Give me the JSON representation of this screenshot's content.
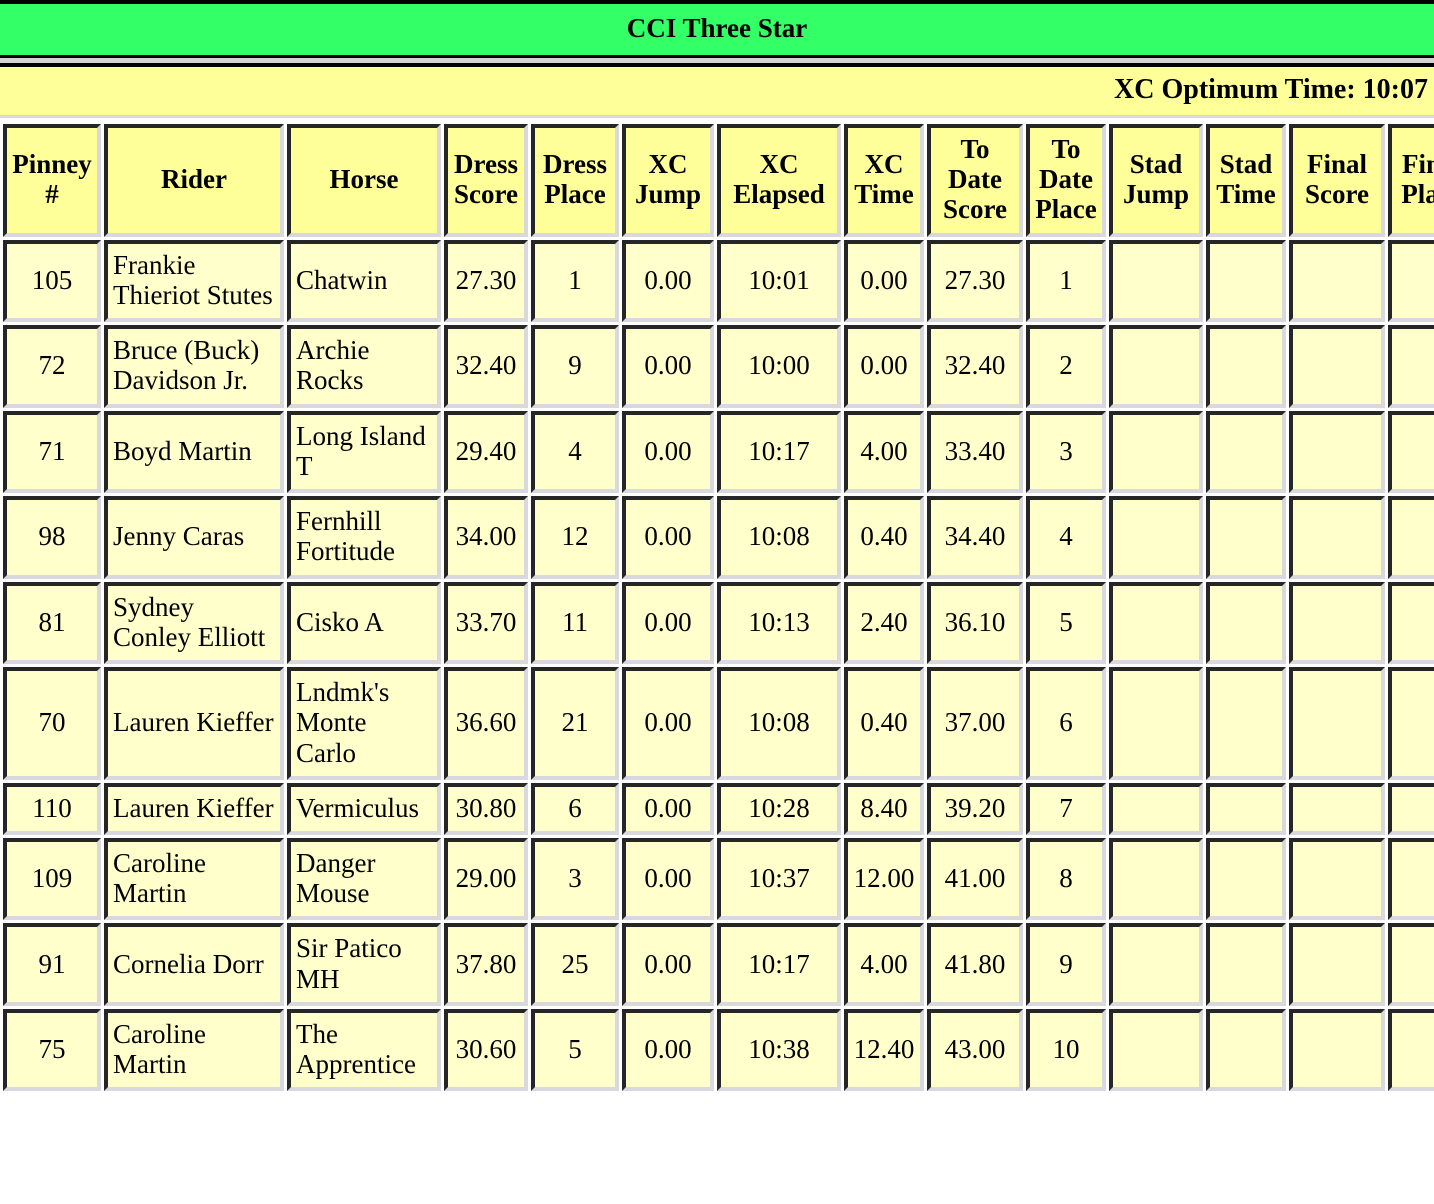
{
  "title": "CCI Three Star",
  "subtitle": "XC Optimum Time: 10:07",
  "colors": {
    "title_bar": "#33ff66",
    "header_cell": "#ffff99",
    "data_cell": "#ffffcc",
    "border_dark": "#262626",
    "border_light": "#d8d8de",
    "text": "#000000"
  },
  "columns": [
    {
      "label": "Pinney #",
      "line1": "Pinney",
      "line2": "#"
    },
    {
      "label": "Rider",
      "line1": "Rider",
      "line2": ""
    },
    {
      "label": "Horse",
      "line1": "Horse",
      "line2": ""
    },
    {
      "label": "Dress Score",
      "line1": "Dress",
      "line2": "Score"
    },
    {
      "label": "Dress Place",
      "line1": "Dress",
      "line2": "Place"
    },
    {
      "label": "XC Jump",
      "line1": "XC",
      "line2": "Jump"
    },
    {
      "label": "XC Elapsed",
      "line1": "XC",
      "line2": "Elapsed"
    },
    {
      "label": "XC Time",
      "line1": "XC",
      "line2": "Time"
    },
    {
      "label": "To Date Score",
      "line1": "To",
      "line2": "Date",
      "line3": "Score"
    },
    {
      "label": "To Date Place",
      "line1": "To",
      "line2": "Date",
      "line3": "Place"
    },
    {
      "label": "Stad Jump",
      "line1": "Stad",
      "line2": "Jump"
    },
    {
      "label": "Stad Time",
      "line1": "Stad",
      "line2": "Time"
    },
    {
      "label": "Final Score",
      "line1": "Final",
      "line2": "Score"
    },
    {
      "label": "Final Place",
      "line1": "Final",
      "line2": "Place"
    }
  ],
  "rows": [
    {
      "pinney": "105",
      "rider": "Frankie Thieriot Stutes",
      "horse": "Chatwin",
      "dress_score": "27.30",
      "dress_place": "1",
      "xc_jump": "0.00",
      "xc_elapsed": "10:01",
      "xc_time": "0.00",
      "to_date_score": "27.30",
      "to_date_place": "1",
      "stad_jump": "",
      "stad_time": "",
      "final_score": "",
      "final_place": ""
    },
    {
      "pinney": "72",
      "rider": "Bruce (Buck) Davidson Jr.",
      "horse": "Archie Rocks",
      "dress_score": "32.40",
      "dress_place": "9",
      "xc_jump": "0.00",
      "xc_elapsed": "10:00",
      "xc_time": "0.00",
      "to_date_score": "32.40",
      "to_date_place": "2",
      "stad_jump": "",
      "stad_time": "",
      "final_score": "",
      "final_place": ""
    },
    {
      "pinney": "71",
      "rider": "Boyd Martin",
      "horse": "Long Island T",
      "dress_score": "29.40",
      "dress_place": "4",
      "xc_jump": "0.00",
      "xc_elapsed": "10:17",
      "xc_time": "4.00",
      "to_date_score": "33.40",
      "to_date_place": "3",
      "stad_jump": "",
      "stad_time": "",
      "final_score": "",
      "final_place": ""
    },
    {
      "pinney": "98",
      "rider": "Jenny Caras",
      "horse": "Fernhill Fortitude",
      "dress_score": "34.00",
      "dress_place": "12",
      "xc_jump": "0.00",
      "xc_elapsed": "10:08",
      "xc_time": "0.40",
      "to_date_score": "34.40",
      "to_date_place": "4",
      "stad_jump": "",
      "stad_time": "",
      "final_score": "",
      "final_place": ""
    },
    {
      "pinney": "81",
      "rider": "Sydney Conley Elliott",
      "horse": "Cisko A",
      "dress_score": "33.70",
      "dress_place": "11",
      "xc_jump": "0.00",
      "xc_elapsed": "10:13",
      "xc_time": "2.40",
      "to_date_score": "36.10",
      "to_date_place": "5",
      "stad_jump": "",
      "stad_time": "",
      "final_score": "",
      "final_place": ""
    },
    {
      "pinney": "70",
      "rider": "Lauren Kieffer",
      "horse": "Lndmk's Monte Carlo",
      "dress_score": "36.60",
      "dress_place": "21",
      "xc_jump": "0.00",
      "xc_elapsed": "10:08",
      "xc_time": "0.40",
      "to_date_score": "37.00",
      "to_date_place": "6",
      "stad_jump": "",
      "stad_time": "",
      "final_score": "",
      "final_place": ""
    },
    {
      "pinney": "110",
      "rider": "Lauren Kieffer",
      "horse": "Vermiculus",
      "dress_score": "30.80",
      "dress_place": "6",
      "xc_jump": "0.00",
      "xc_elapsed": "10:28",
      "xc_time": "8.40",
      "to_date_score": "39.20",
      "to_date_place": "7",
      "stad_jump": "",
      "stad_time": "",
      "final_score": "",
      "final_place": ""
    },
    {
      "pinney": "109",
      "rider": "Caroline Martin",
      "horse": "Danger Mouse",
      "dress_score": "29.00",
      "dress_place": "3",
      "xc_jump": "0.00",
      "xc_elapsed": "10:37",
      "xc_time": "12.00",
      "to_date_score": "41.00",
      "to_date_place": "8",
      "stad_jump": "",
      "stad_time": "",
      "final_score": "",
      "final_place": ""
    },
    {
      "pinney": "91",
      "rider": "Cornelia Dorr",
      "horse": "Sir Patico MH",
      "dress_score": "37.80",
      "dress_place": "25",
      "xc_jump": "0.00",
      "xc_elapsed": "10:17",
      "xc_time": "4.00",
      "to_date_score": "41.80",
      "to_date_place": "9",
      "stad_jump": "",
      "stad_time": "",
      "final_score": "",
      "final_place": ""
    },
    {
      "pinney": "75",
      "rider": "Caroline Martin",
      "horse": "The Apprentice",
      "dress_score": "30.60",
      "dress_place": "5",
      "xc_jump": "0.00",
      "xc_elapsed": "10:38",
      "xc_time": "12.40",
      "to_date_score": "43.00",
      "to_date_place": "10",
      "stad_jump": "",
      "stad_time": "",
      "final_score": "",
      "final_place": ""
    }
  ]
}
